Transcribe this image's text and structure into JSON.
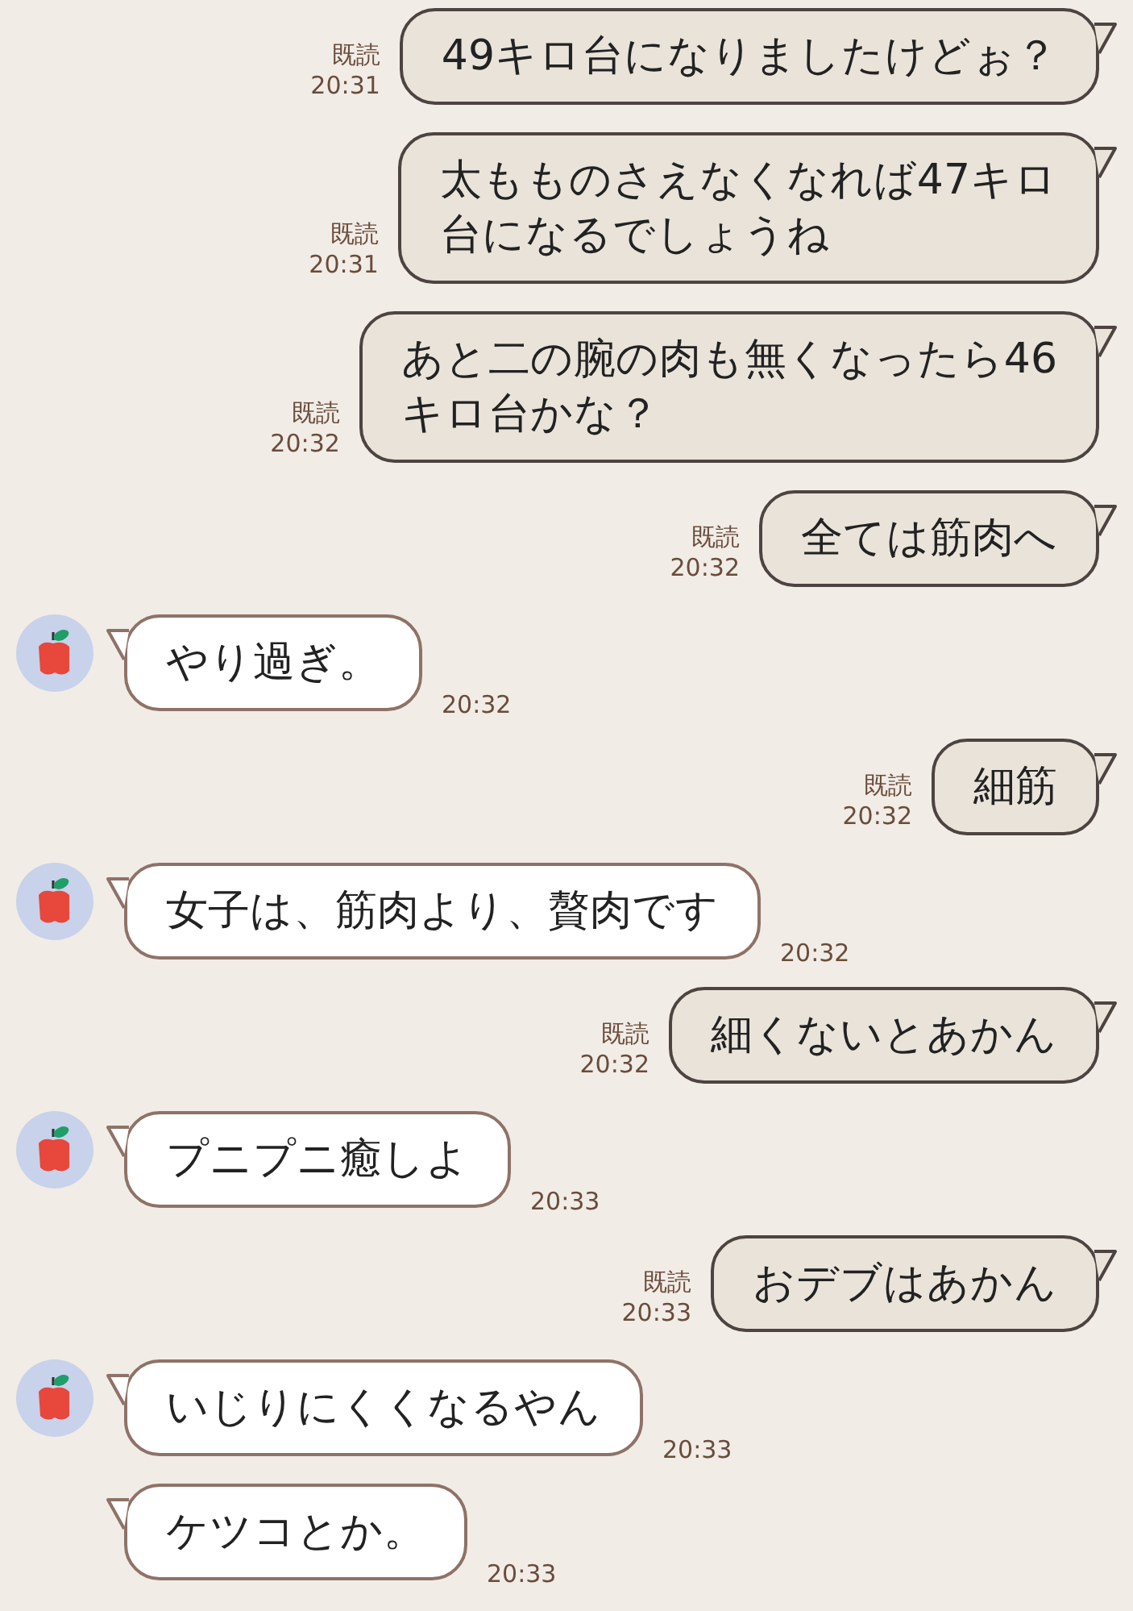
{
  "messages": [
    {
      "kind": "sent",
      "lines": [
        "49キロ台になりましたけどぉ？"
      ],
      "read": "既読",
      "time": "20:31"
    },
    {
      "kind": "sent",
      "lines": [
        "太もものさえなくなれば47キロ",
        "台になるでしょうね"
      ],
      "read": "既読",
      "time": "20:31"
    },
    {
      "kind": "sent",
      "lines": [
        "あと二の腕の肉も無くなったら46",
        "キロ台かな？"
      ],
      "read": "既読",
      "time": "20:32"
    },
    {
      "kind": "sent",
      "lines": [
        "全ては筋肉へ"
      ],
      "read": "既読",
      "time": "20:32"
    },
    {
      "kind": "received",
      "lines": [
        "やり過ぎ。"
      ],
      "time": "20:32",
      "show_avatar": true
    },
    {
      "kind": "sent",
      "lines": [
        "細筋"
      ],
      "read": "既読",
      "time": "20:32"
    },
    {
      "kind": "received",
      "lines": [
        "女子は、筋肉より、贅肉です"
      ],
      "time": "20:32",
      "show_avatar": true
    },
    {
      "kind": "sent",
      "lines": [
        "細くないとあかん"
      ],
      "read": "既読",
      "time": "20:32"
    },
    {
      "kind": "received",
      "lines": [
        "プニプニ癒しよ"
      ],
      "time": "20:33",
      "show_avatar": true
    },
    {
      "kind": "sent",
      "lines": [
        "おデブはあかん"
      ],
      "read": "既読",
      "time": "20:33"
    },
    {
      "kind": "received",
      "lines": [
        "いじりにくくなるやん"
      ],
      "time": "20:33",
      "show_avatar": true
    },
    {
      "kind": "received",
      "lines": [
        "ケツコとか。"
      ],
      "time": "20:33",
      "show_avatar": false
    }
  ]
}
